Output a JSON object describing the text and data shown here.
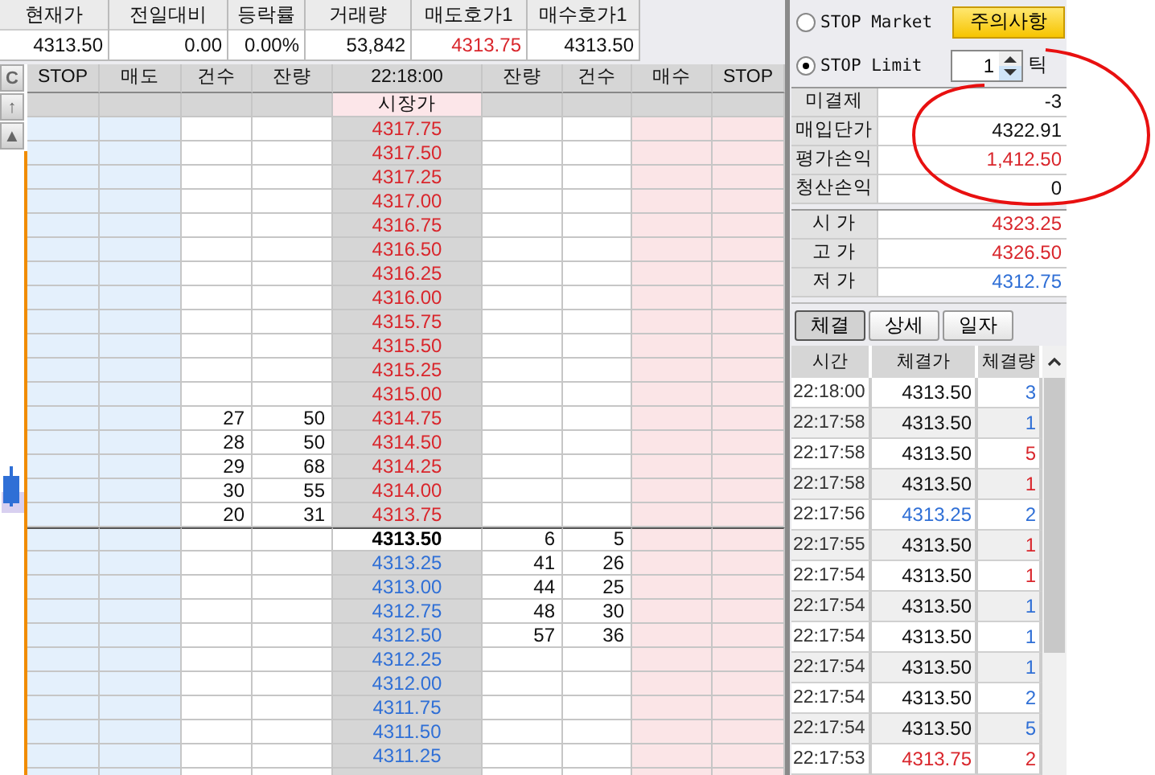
{
  "summary": [
    {
      "label": "현재가",
      "value": "4313.50",
      "color": "#111111"
    },
    {
      "label": "전일대비",
      "value": "0.00",
      "color": "#111111"
    },
    {
      "label": "등락률",
      "value": "0.00%",
      "color": "#111111"
    },
    {
      "label": "거래량",
      "value": "53,842",
      "color": "#111111"
    },
    {
      "label": "매도호가1",
      "value": "4313.75",
      "color": "#d9262c"
    },
    {
      "label": "매수호가1",
      "value": "4313.50",
      "color": "#111111"
    }
  ],
  "side_buttons": [
    "C",
    "↑",
    "▲"
  ],
  "order_book": {
    "header": [
      "STOP",
      "매도",
      "건수",
      "잔량",
      "22:18:00",
      "잔량",
      "건수",
      "매수",
      "STOP"
    ],
    "market_label": "시장가",
    "rows": [
      {
        "kind": "ask",
        "price": "4317.75"
      },
      {
        "kind": "ask",
        "price": "4317.50"
      },
      {
        "kind": "ask",
        "price": "4317.25"
      },
      {
        "kind": "ask",
        "price": "4317.00"
      },
      {
        "kind": "ask",
        "price": "4316.75"
      },
      {
        "kind": "ask",
        "price": "4316.50"
      },
      {
        "kind": "ask",
        "price": "4316.25"
      },
      {
        "kind": "ask",
        "price": "4316.00"
      },
      {
        "kind": "ask",
        "price": "4315.75"
      },
      {
        "kind": "ask",
        "price": "4315.50"
      },
      {
        "kind": "ask",
        "price": "4315.25"
      },
      {
        "kind": "ask",
        "price": "4315.00"
      },
      {
        "kind": "ask",
        "price": "4314.75",
        "count": "27",
        "qty": "50"
      },
      {
        "kind": "ask",
        "price": "4314.50",
        "count": "28",
        "qty": "50"
      },
      {
        "kind": "ask",
        "price": "4314.25",
        "count": "29",
        "qty": "68"
      },
      {
        "kind": "ask",
        "price": "4314.00",
        "count": "30",
        "qty": "55"
      },
      {
        "kind": "ask",
        "price": "4313.75",
        "count": "20",
        "qty": "31"
      },
      {
        "kind": "current",
        "price": "4313.50",
        "qty": "6",
        "count": "5"
      },
      {
        "kind": "bid",
        "price": "4313.25",
        "qty": "41",
        "count": "26"
      },
      {
        "kind": "bid",
        "price": "4313.00",
        "qty": "44",
        "count": "25"
      },
      {
        "kind": "bid",
        "price": "4312.75",
        "qty": "48",
        "count": "30"
      },
      {
        "kind": "bid",
        "price": "4312.50",
        "qty": "57",
        "count": "36"
      },
      {
        "kind": "bid",
        "price": "4312.25"
      },
      {
        "kind": "bid",
        "price": "4312.00"
      },
      {
        "kind": "bid",
        "price": "4311.75"
      },
      {
        "kind": "bid",
        "price": "4311.50"
      },
      {
        "kind": "bid",
        "price": "4311.25"
      }
    ]
  },
  "stop_options": [
    {
      "label": "STOP Market",
      "selected": false
    },
    {
      "label": "STOP Limit",
      "selected": true
    }
  ],
  "caution_button": "주의사항",
  "tick_input": {
    "value": "1",
    "unit": "틱"
  },
  "position": [
    {
      "label": "미결제",
      "value": "-3",
      "color": "#111111"
    },
    {
      "label": "매입단가",
      "value": "4322.91",
      "color": "#111111"
    },
    {
      "label": "평가손익",
      "value": "1,412.50",
      "color": "#d9262c"
    },
    {
      "label": "청산손익",
      "value": "0",
      "color": "#111111"
    }
  ],
  "prices": [
    {
      "label": "시 가",
      "value": "4323.25",
      "color": "#d9262c"
    },
    {
      "label": "고 가",
      "value": "4326.50",
      "color": "#d9262c"
    },
    {
      "label": "저 가",
      "value": "4312.75",
      "color": "#2f6fd6"
    }
  ],
  "tabs": [
    {
      "label": "체결",
      "selected": true
    },
    {
      "label": "상세",
      "selected": false
    },
    {
      "label": "일자",
      "selected": false
    }
  ],
  "trades": {
    "columns": [
      "시간",
      "체결가",
      "체결량"
    ],
    "rows": [
      {
        "time": "22:18:00",
        "price": {
          "text": "4313.50",
          "color": "#111111"
        },
        "qty": {
          "text": "3",
          "color": "#2f6fd6"
        }
      },
      {
        "time": "22:17:58",
        "price": {
          "text": "4313.50",
          "color": "#111111"
        },
        "qty": {
          "text": "1",
          "color": "#2f6fd6"
        }
      },
      {
        "time": "22:17:58",
        "price": {
          "text": "4313.50",
          "color": "#111111"
        },
        "qty": {
          "text": "5",
          "color": "#d9262c"
        }
      },
      {
        "time": "22:17:58",
        "price": {
          "text": "4313.50",
          "color": "#111111"
        },
        "qty": {
          "text": "1",
          "color": "#d9262c"
        }
      },
      {
        "time": "22:17:56",
        "price": {
          "text": "4313.25",
          "color": "#2f6fd6"
        },
        "qty": {
          "text": "2",
          "color": "#2f6fd6"
        }
      },
      {
        "time": "22:17:55",
        "price": {
          "text": "4313.50",
          "color": "#111111"
        },
        "qty": {
          "text": "1",
          "color": "#d9262c"
        }
      },
      {
        "time": "22:17:54",
        "price": {
          "text": "4313.50",
          "color": "#111111"
        },
        "qty": {
          "text": "1",
          "color": "#d9262c"
        }
      },
      {
        "time": "22:17:54",
        "price": {
          "text": "4313.50",
          "color": "#111111"
        },
        "qty": {
          "text": "1",
          "color": "#2f6fd6"
        }
      },
      {
        "time": "22:17:54",
        "price": {
          "text": "4313.50",
          "color": "#111111"
        },
        "qty": {
          "text": "1",
          "color": "#2f6fd6"
        }
      },
      {
        "time": "22:17:54",
        "price": {
          "text": "4313.50",
          "color": "#111111"
        },
        "qty": {
          "text": "1",
          "color": "#2f6fd6"
        }
      },
      {
        "time": "22:17:54",
        "price": {
          "text": "4313.50",
          "color": "#111111"
        },
        "qty": {
          "text": "2",
          "color": "#2f6fd6"
        }
      },
      {
        "time": "22:17:54",
        "price": {
          "text": "4313.50",
          "color": "#111111"
        },
        "qty": {
          "text": "5",
          "color": "#2f6fd6"
        }
      },
      {
        "time": "22:17:53",
        "price": {
          "text": "4313.75",
          "color": "#d9262c"
        },
        "qty": {
          "text": "2",
          "color": "#d9262c"
        }
      }
    ]
  }
}
